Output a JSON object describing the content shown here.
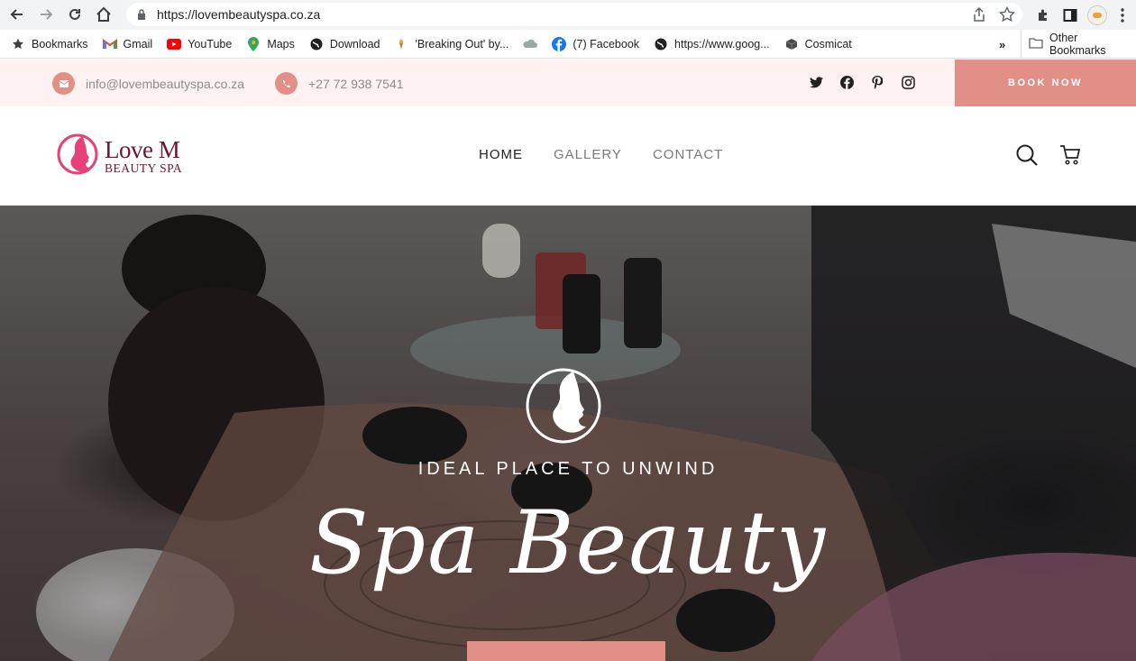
{
  "browser": {
    "url": "https://lovembeautyspa.co.za",
    "bookmarks": [
      {
        "label": "Bookmarks",
        "icon": "star-icon"
      },
      {
        "label": "Gmail",
        "icon": "gmail-icon"
      },
      {
        "label": "YouTube",
        "icon": "youtube-icon"
      },
      {
        "label": "Maps",
        "icon": "maps-icon"
      },
      {
        "label": "Download",
        "icon": "globe-icon"
      },
      {
        "label": "'Breaking Out' by...",
        "icon": "bookmark-favicon"
      },
      {
        "label": "",
        "icon": "cloud-favicon"
      },
      {
        "label": "(7) Facebook",
        "icon": "facebook-icon"
      },
      {
        "label": "https://www.goog...",
        "icon": "globe-icon"
      },
      {
        "label": "Cosmicat",
        "icon": "cube-icon"
      }
    ],
    "more_label": "»",
    "other_bookmarks": "Other Bookmarks"
  },
  "topbar": {
    "email": "info@lovembeautyspa.co.za",
    "phone": "+27 72 938 7541",
    "book_now": "BOOK NOW",
    "socials": [
      "twitter-icon",
      "facebook-icon",
      "pinterest-icon",
      "instagram-icon"
    ]
  },
  "header": {
    "logo_line1": "Love M",
    "logo_line2": "BEAUTY SPA",
    "menu": [
      {
        "label": "HOME",
        "active": true
      },
      {
        "label": "GALLERY",
        "active": false
      },
      {
        "label": "CONTACT",
        "active": false
      }
    ]
  },
  "hero": {
    "subtitle": "IDEAL PLACE TO UNWIND",
    "title": "Spa Beauty"
  },
  "colors": {
    "accent": "#e29087",
    "brand": "#6e1535",
    "logo_pink": "#e8407a",
    "topbar_bg": "#fdf1f1"
  }
}
